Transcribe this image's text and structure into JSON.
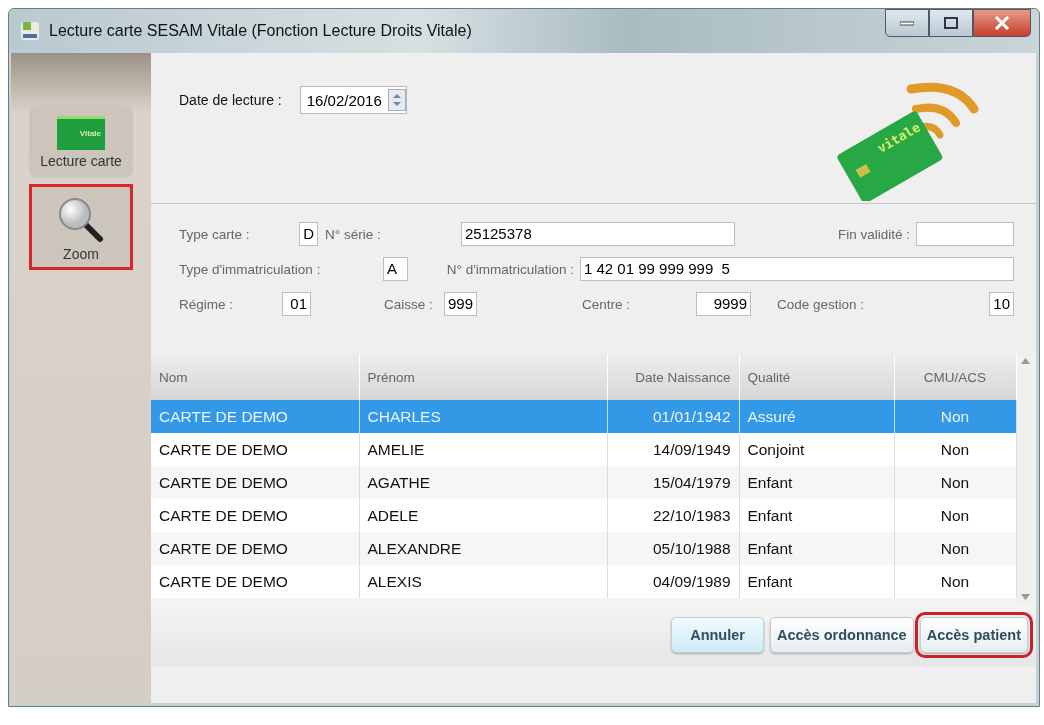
{
  "window": {
    "title": "Lecture carte SESAM Vitale (Fonction Lecture Droits Vitale)"
  },
  "sidebar": {
    "items": [
      {
        "kind": "card",
        "label": "Lecture carte",
        "icon_text": "Vitale",
        "highlighted": false
      },
      {
        "kind": "zoom",
        "label": "Zoom",
        "highlighted": true
      }
    ]
  },
  "date": {
    "label": "Date de lecture :",
    "value": "16/02/2016"
  },
  "card_illustration": {
    "text": "vitale"
  },
  "fields": [
    [
      {
        "label": "Type carte :",
        "value": "D"
      },
      {
        "label": "N° série :",
        "value": "25125378"
      },
      {
        "label": "Fin validité :"
      }
    ],
    [
      {
        "label": "Type d'immatriculation :",
        "value": "A"
      },
      {
        "label": "N° d'immatriculation :",
        "value": "1 42 01 99 999 999  5"
      }
    ],
    [
      {
        "label": "Régime :",
        "value": "01"
      },
      {
        "label": "Caisse :",
        "value": "999"
      },
      {
        "label": "Centre :",
        "value": "9999"
      },
      {
        "label": "Code gestion :",
        "value": "10"
      }
    ]
  ],
  "table": {
    "columns": [
      "Nom",
      "Prénom",
      "Date Naissance",
      "Qualité",
      "CMU/ACS"
    ],
    "rows": [
      {
        "cells": [
          "CARTE DE DEMO",
          "CHARLES",
          "01/01/1942",
          "Assuré",
          "Non"
        ],
        "selected": true
      },
      {
        "cells": [
          "CARTE DE DEMO",
          "AMELIE",
          "14/09/1949",
          "Conjoint",
          "Non"
        ],
        "selected": false
      },
      {
        "cells": [
          "CARTE DE DEMO",
          "AGATHE",
          "15/04/1979",
          "Enfant",
          "Non"
        ],
        "selected": false
      },
      {
        "cells": [
          "CARTE DE DEMO",
          "ADELE",
          "22/10/1983",
          "Enfant",
          "Non"
        ],
        "selected": false
      },
      {
        "cells": [
          "CARTE DE DEMO",
          "ALEXANDRE",
          "05/10/1988",
          "Enfant",
          "Non"
        ],
        "selected": false
      },
      {
        "cells": [
          "CARTE DE DEMO",
          "ALEXIS",
          "04/09/1989",
          "Enfant",
          "Non"
        ],
        "selected": false
      }
    ]
  },
  "buttons": [
    {
      "label": "Annuler",
      "highlighted": false
    },
    {
      "label": "Accès ordonnance",
      "highlighted": false
    },
    {
      "label": "Accès patient",
      "highlighted": true
    }
  ]
}
